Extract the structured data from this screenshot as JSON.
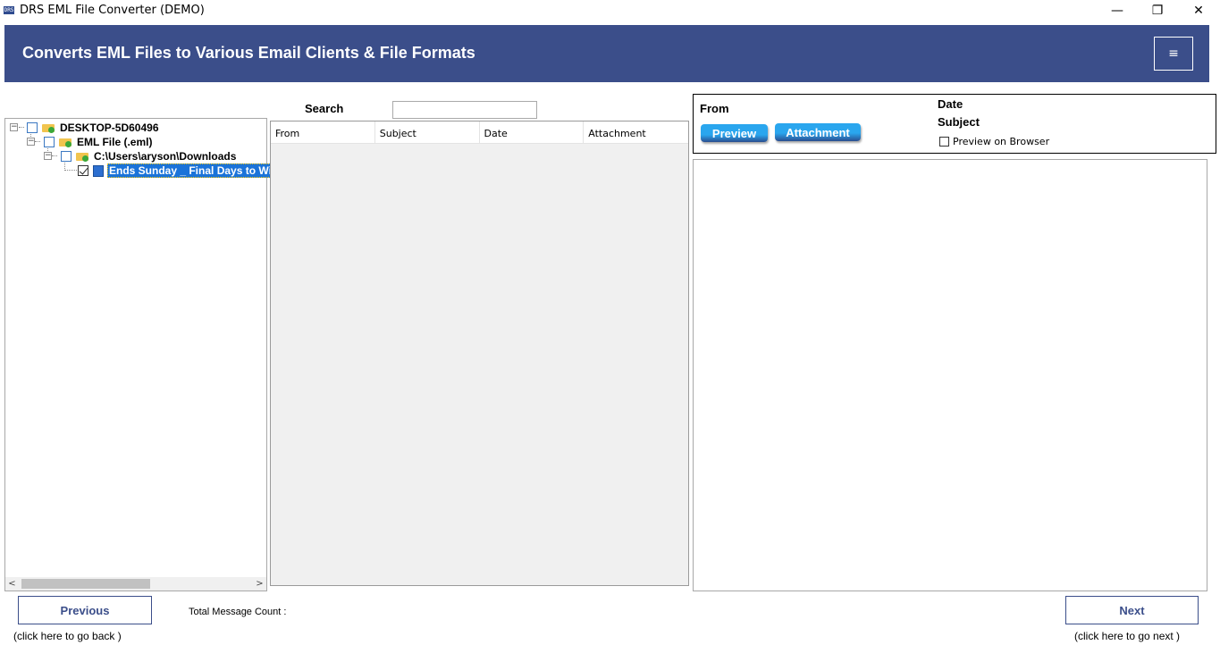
{
  "window": {
    "title": "DRS EML File Converter (DEMO)",
    "minimize_glyph": "—",
    "restore_glyph": "❐",
    "close_glyph": "✕"
  },
  "banner": {
    "title": "Converts EML Files to Various Email Clients & File Formats",
    "menu_glyph": "≡"
  },
  "tree": {
    "nodes": [
      {
        "label": "DESKTOP-5D60496",
        "checked": false,
        "icon": "folder-icon"
      },
      {
        "label": "EML File (.eml)",
        "checked": false,
        "icon": "folder-icon"
      },
      {
        "label": "C:\\Users\\aryson\\Downloads",
        "checked": false,
        "icon": "folder-icon"
      },
      {
        "label": "Ends Sunday _ Final Days to Win",
        "checked": true,
        "icon": "document-icon",
        "selected": true
      }
    ],
    "collapse_glyph": "−",
    "scroll_left": "<",
    "scroll_right": ">"
  },
  "search": {
    "label": "Search",
    "value": "",
    "placeholder": ""
  },
  "grid": {
    "columns": [
      "From",
      "Subject",
      "Date",
      "Attachment"
    ],
    "rows": []
  },
  "preview": {
    "from_label": "From",
    "date_label": "Date",
    "subject_label": "Subject",
    "preview_button": "Preview",
    "attachment_button": "Attachment",
    "browser_checkbox_label": "Preview on Browser",
    "browser_checked": false
  },
  "footer": {
    "previous_label": "Previous",
    "previous_hint": "(click here to  go back )",
    "next_label": "Next",
    "next_hint": "(click here to  go next )",
    "count_label": "Total Message Count :",
    "count_value": ""
  },
  "colors": {
    "banner": "#3b4e8a",
    "accent_blue": "#2aa6ee",
    "selection": "#1a73d9"
  }
}
